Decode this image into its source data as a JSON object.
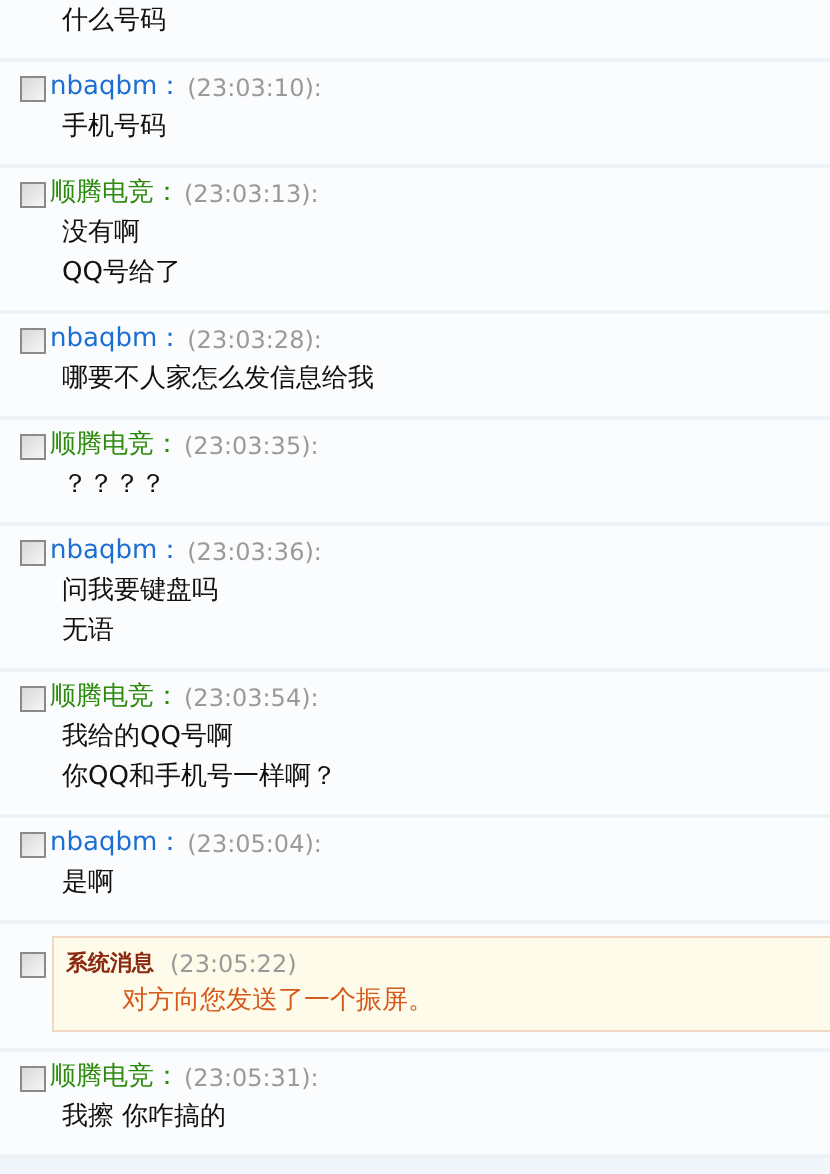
{
  "messages": [
    {
      "kind": "fragment",
      "lines": [
        "什么号码"
      ]
    },
    {
      "kind": "chat",
      "checked": false,
      "sender": "nbaqbm：",
      "color": "#1c6fd0",
      "time": "(23:03:10):",
      "lines": [
        "手机号码"
      ]
    },
    {
      "kind": "chat",
      "checked": false,
      "sender": "顺腾电竞：",
      "color": "#2c8a0c",
      "time": "(23:03:13):",
      "lines": [
        "没有啊",
        "QQ号给了"
      ]
    },
    {
      "kind": "chat",
      "checked": false,
      "sender": "nbaqbm：",
      "color": "#1c6fd0",
      "time": "(23:03:28):",
      "lines": [
        "哪要不人家怎么发信息给我"
      ]
    },
    {
      "kind": "chat",
      "checked": false,
      "sender": "顺腾电竞：",
      "color": "#2c8a0c",
      "time": "(23:03:35):",
      "lines": [
        "？？？？"
      ]
    },
    {
      "kind": "chat",
      "checked": false,
      "sender": "nbaqbm：",
      "color": "#1c6fd0",
      "time": "(23:03:36):",
      "lines": [
        "问我要键盘吗",
        "无语"
      ]
    },
    {
      "kind": "chat",
      "checked": false,
      "sender": "顺腾电竞：",
      "color": "#2c8a0c",
      "time": "(23:03:54):",
      "lines": [
        "我给的QQ号啊",
        "你QQ和手机号一样啊？"
      ]
    },
    {
      "kind": "chat",
      "checked": false,
      "sender": "nbaqbm：",
      "color": "#1c6fd0",
      "time": "(23:05:04):",
      "lines": [
        "是啊"
      ]
    },
    {
      "kind": "system",
      "checked": false,
      "sender": "系统消息",
      "time": "(23:05:22)",
      "lines": [
        "对方向您发送了一个振屏。"
      ]
    },
    {
      "kind": "chat",
      "checked": false,
      "sender": "顺腾电竞：",
      "color": "#2c8a0c",
      "time": "(23:05:31):",
      "lines": [
        "我擦 你咋搞的"
      ]
    }
  ]
}
